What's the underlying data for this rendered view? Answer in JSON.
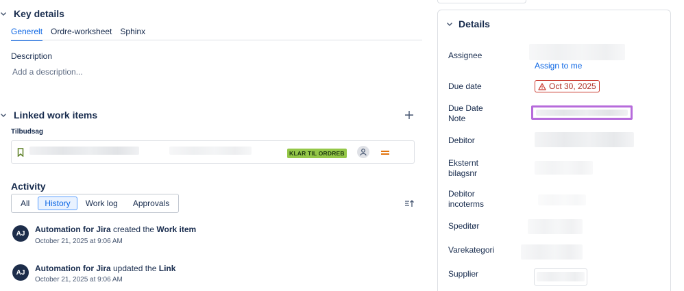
{
  "key_details": {
    "title": "Key details",
    "tabs": [
      {
        "label": "Generelt"
      },
      {
        "label": "Ordre-worksheet"
      },
      {
        "label": "Sphinx"
      }
    ],
    "description_label": "Description",
    "description_placeholder": "Add a description..."
  },
  "linked_items": {
    "title": "Linked work items",
    "group_label": "Tilbudsag",
    "item": {
      "status": "KLAR TIL ORDREB"
    }
  },
  "activity": {
    "title": "Activity",
    "filters": [
      {
        "label": "All"
      },
      {
        "label": "History"
      },
      {
        "label": "Work log"
      },
      {
        "label": "Approvals"
      }
    ],
    "entries": [
      {
        "initials": "AJ",
        "actor": "Automation for Jira",
        "verb": " created the ",
        "object": "Work item",
        "time": "October 21, 2025 at 9:06 AM"
      },
      {
        "initials": "AJ",
        "actor": "Automation for Jira",
        "verb": " updated the ",
        "object": "Link",
        "time": "October 21, 2025 at 9:06 AM"
      }
    ]
  },
  "details": {
    "title": "Details",
    "assignee_label": "Assignee",
    "assign_to_me": "Assign to me",
    "due_date_label": "Due date",
    "due_date_value": "Oct 30, 2025",
    "due_date_note_label_1": "Due Date",
    "due_date_note_label_2": "Note",
    "debitor_label": "Debitor",
    "eksternt_label_1": "Eksternt",
    "eksternt_label_2": "bilagsnr",
    "incoterms_label_1": "Debitor",
    "incoterms_label_2": "incoterms",
    "speditor_label": "Speditør",
    "varekategori_label": "Varekategori",
    "supplier_label": "Supplier"
  },
  "colors": {
    "accent": "#0c66e4",
    "danger": "#ae2e24",
    "status_green": "#94c748",
    "highlight_purple": "#b66bdb"
  }
}
